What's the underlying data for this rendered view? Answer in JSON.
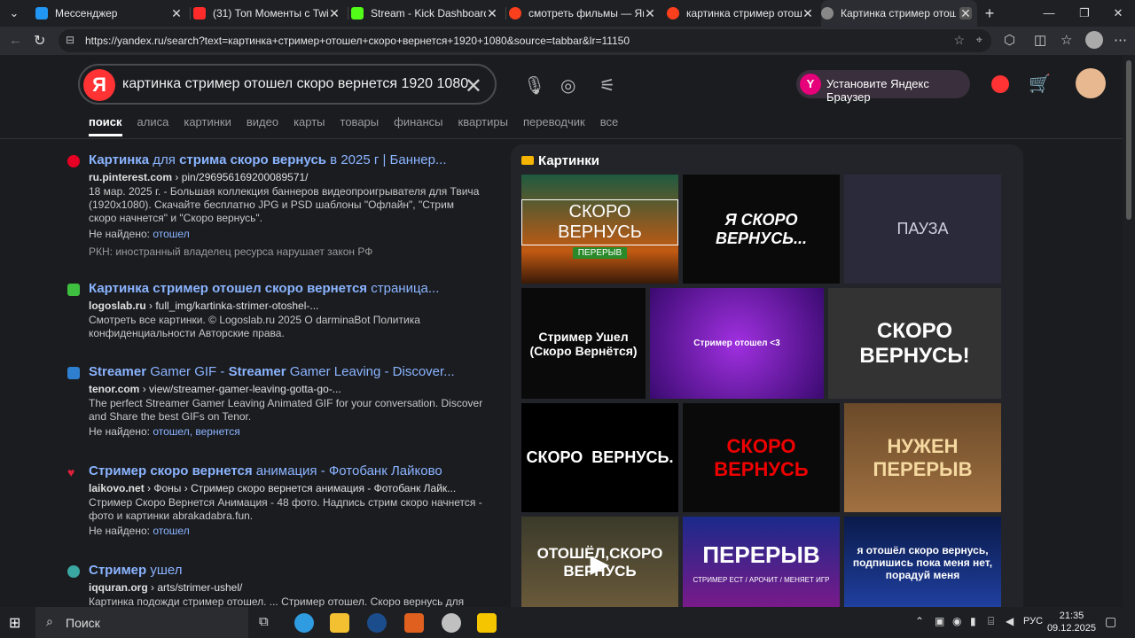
{
  "tabs": [
    {
      "title": "Мессенджер",
      "color": "#2196f3"
    },
    {
      "title": "(31) Топ Моменты с Twitch",
      "color": "#ff2a2a"
    },
    {
      "title": "Stream - Kick Dashboard",
      "color": "#53fc18"
    },
    {
      "title": "смотреть фильмы — Яндекс",
      "color": "#fc3f1d"
    },
    {
      "title": "картинка стример отошел",
      "color": "#fc3f1d"
    },
    {
      "title": "Картинка стример отошел",
      "color": "#888888"
    }
  ],
  "address": {
    "url": "https://yandex.ru/search?text=картинка+стример+отошел+скоро+вернется+1920+1080&source=tabbar&lr=11150"
  },
  "search": {
    "logo": "Я",
    "query": "картинка стример отошел скоро вернется 1920 1080",
    "clear": "✕"
  },
  "promo": {
    "label": "Установите Яндекс Браузер",
    "logo": "Y"
  },
  "nav": [
    "поиск",
    "алиса",
    "картинки",
    "видео",
    "карты",
    "товары",
    "финансы",
    "квартиры",
    "переводчик",
    "все"
  ],
  "results": [
    {
      "title_a": "Картинка",
      "title_b": " для ",
      "title_c": "стрима скоро вернусь",
      "title_d": " в 2025 г | Баннер...",
      "url_a": "ru.pinterest.com",
      "url_b": " › pin/296956169200089571/",
      "desc": "18 мар. 2025 г. - Большая коллекция баннеров видеопроигрывателя для Твича (1920x1080). Скачайте бесплатно JPG и PSD шаблоны \"Офлайн\", \"Стрим скоро начнется\" и \"Скоро вернусь\".",
      "nf_label": "Не найдено:",
      "nf_words": "отошел",
      "rkn": "РКН: иностранный владелец ресурса нарушает закон РФ",
      "icon": "#e60023"
    },
    {
      "title_a": "Картинка стример отошел скоро вернется",
      "title_b": " страница...",
      "url_a": "logoslab.ru",
      "url_b": " › full_img/kartinka-strimer-otoshel-...",
      "desc": "Смотреть все картинки. © Logoslab.ru 2025 О darminaBot Политика конфиденциальности Авторские права.",
      "icon": "#3fbf3f"
    },
    {
      "title_a": "Streamer",
      "title_b": " Gamer GIF - ",
      "title_c": "Streamer",
      "title_d": " Gamer Leaving - Discover...",
      "url_a": "tenor.com",
      "url_b": " › view/streamer-gamer-leaving-gotta-go-...",
      "desc": "The perfect Streamer Gamer Leaving Animated GIF for your conversation. Discover and Share the best GIFs on Tenor.",
      "nf_label": "Не найдено:",
      "nf_words": "отошел, вернется",
      "icon": "#2f7fd0"
    },
    {
      "title_a": "Стример скоро вернется",
      "title_b": " анимация - Фотобанк Лайково",
      "url_a": "laikovo.net",
      "url_b": " › Фоны › Стример скоро вернется анимация - Фотобанк Лайк...",
      "desc": "Стример Скоро Вернется Анимация - 48 фото. Надпись стрим скоро начнется - фото и картинки abrakadabra.fun.",
      "nf_label": "Не найдено:",
      "nf_words": "отошел",
      "icon": "#e0213a"
    },
    {
      "title_a": "Стример",
      "title_b": " ушел",
      "url_a": "iqquran.org",
      "url_b": " › arts/strimer-ushel/",
      "desc": "Картинка подожди стример отошел. ... Стример отошел. Скоро вернусь для",
      "icon": "#3aa7a0"
    }
  ],
  "images": {
    "title": "Картинки",
    "tiles": [
      "СКОРО ВЕРНУСЬ",
      "ПЕРЕРЫВ",
      "Я СКОРО ВЕРНУСЬ...",
      "ПАУЗА",
      "Стример Ушел (Скоро Вернётся)",
      "Стример отошел <3",
      "СКОРО ВЕРНУСЬ!",
      "СКОРО  ВЕРНУСЬ.",
      "СКОРО ВЕРНУСЬ",
      "НУЖЕН ПЕРЕРЫВ",
      "ОТОШЁЛ,СКОРО ВЕРНУСЬ",
      "ПЕРЕРЫВ",
      "СТРИМЕР ЕСТ / АРОЧИТ / МЕНЯЕТ ИГР",
      "я отошёл скоро вернусь, подпишись пока меня нет, порадуй меня"
    ]
  },
  "taskbar": {
    "search": "Поиск",
    "lang": "РУС",
    "time": "21:35",
    "date": "09.12.2025"
  }
}
